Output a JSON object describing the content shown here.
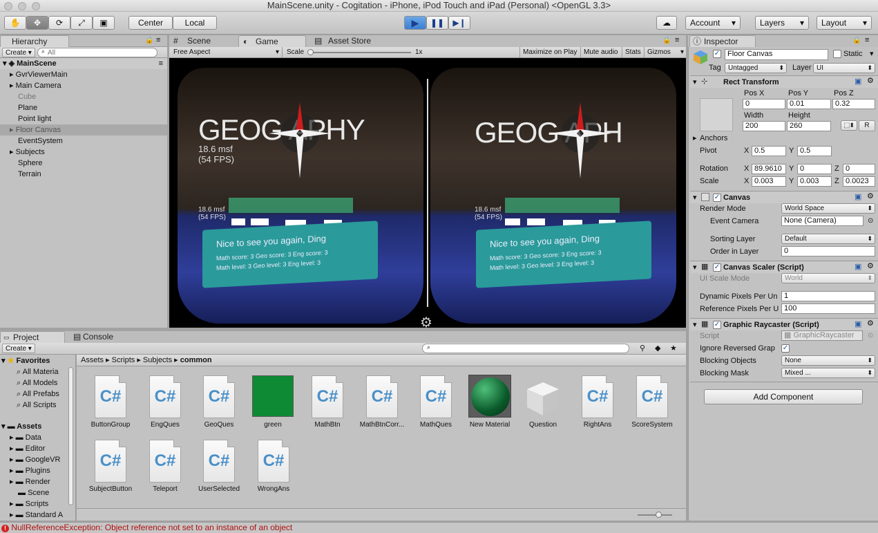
{
  "window": {
    "title": "MainScene.unity - Cogitation - iPhone, iPod Touch and iPad (Personal) <OpenGL 3.3>"
  },
  "toolbar": {
    "center": "Center",
    "local": "Local",
    "account": "Account",
    "layers": "Layers",
    "layout": "Layout"
  },
  "hierarchy": {
    "tab": "Hierarchy",
    "create": "Create",
    "search_placeholder": "All",
    "scene": "MainScene",
    "items": [
      "GvrViewerMain",
      "Main Camera",
      "Cube",
      "Plane",
      "Point light",
      "Floor Canvas",
      "EventSystem",
      "Subjects",
      "Sphere",
      "Terrain"
    ]
  },
  "viewtabs": {
    "scene": "Scene",
    "game": "Game",
    "asset_store": "Asset Store"
  },
  "game": {
    "aspect": "Free Aspect",
    "scale_label": "Scale",
    "scale_value": "1x",
    "maximize": "Maximize on Play",
    "mute": "Mute audio",
    "stats": "Stats",
    "gizmos": "Gizmos"
  },
  "vr": {
    "title": "GEOGRAPHY",
    "title_left": "GEOG  APHY",
    "title_right": "GEOG  APH",
    "fps_big": "18.6 msf",
    "fps_big2": "(54 FPS)",
    "fps_small": "18.6 msf",
    "fps_small2": "(54 FPS)",
    "greeting": "Nice to see you again, Ding",
    "scores": "Math score: 3  Geo score: 3  Eng score: 3",
    "levels": "Math level: 3  Geo level: 3  Eng level: 3"
  },
  "project": {
    "tab": "Project",
    "console": "Console",
    "create": "Create",
    "favorites": "Favorites",
    "fav_items": [
      "All Materia",
      "All Models",
      "All Prefabs",
      "All Scripts"
    ],
    "assets": "Assets",
    "asset_folders": [
      "Data",
      "Editor",
      "GoogleVR",
      "Plugins",
      "Render",
      "Scene",
      "Scripts",
      "Standard A"
    ],
    "breadcrumb": [
      "Assets",
      "Scripts",
      "Subjects",
      "common"
    ],
    "files": [
      "ButtonGroup",
      "EngQues",
      "GeoQues",
      "green",
      "MathBtn",
      "MathBtnCorr...",
      "MathQues",
      "New Material",
      "Question",
      "RightAns",
      "ScoreSystem",
      "SubjectButton",
      "Teleport",
      "UserSelected",
      "WrongAns"
    ]
  },
  "inspector": {
    "tab": "Inspector",
    "name": "Floor Canvas",
    "static": "Static",
    "tag_label": "Tag",
    "tag": "Untagged",
    "layer_label": "Layer",
    "layer": "UI",
    "rect": {
      "title": "Rect Transform",
      "posx_l": "Pos X",
      "posy_l": "Pos Y",
      "posz_l": "Pos Z",
      "posx": "0",
      "posy": "0.01",
      "posz": "0.32",
      "width_l": "Width",
      "height_l": "Height",
      "width": "200",
      "height": "260",
      "r": "R",
      "anchors": "Anchors",
      "pivot": "Pivot",
      "pivot_x": "0.5",
      "pivot_y": "0.5",
      "rotation": "Rotation",
      "rot_x": "89.9610",
      "rot_y": "0",
      "rot_z": "0",
      "scale": "Scale",
      "sc_x": "0.003",
      "sc_y": "0.003",
      "sc_z": "0.0023",
      "x": "X",
      "y": "Y",
      "z": "Z"
    },
    "canvas": {
      "title": "Canvas",
      "render_mode_l": "Render Mode",
      "render_mode": "World Space",
      "event_cam_l": "Event Camera",
      "event_cam": "None (Camera)",
      "sorting_l": "Sorting Layer",
      "sorting": "Default",
      "order_l": "Order in Layer",
      "order": "0"
    },
    "scaler": {
      "title": "Canvas Scaler (Script)",
      "ui_mode_l": "UI Scale Mode",
      "ui_mode": "World",
      "dyn_l": "Dynamic Pixels Per Un",
      "dyn": "1",
      "ref_l": "Reference Pixels Per U",
      "ref": "100"
    },
    "raycaster": {
      "title": "Graphic Raycaster (Script)",
      "script_l": "Script",
      "script": "GraphicRaycaster",
      "ignore_l": "Ignore Reversed Grap",
      "block_obj_l": "Blocking Objects",
      "block_obj": "None",
      "block_mask_l": "Blocking Mask",
      "block_mask": "Mixed ..."
    },
    "add_component": "Add Component"
  },
  "status": {
    "error": "NullReferenceException: Object reference not set to an instance of an object"
  }
}
